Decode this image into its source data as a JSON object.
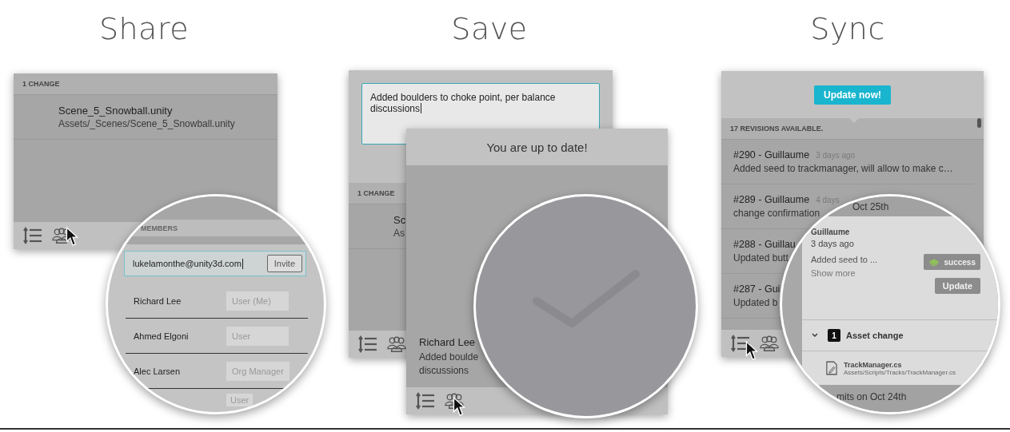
{
  "share": {
    "title": "Share",
    "changes": {
      "header": "1 CHANGE",
      "items": [
        {
          "name": "Scene_5_Snowball.unity",
          "path": "Assets/_Scenes/Scene_5_Snowball.unity"
        }
      ]
    },
    "members": {
      "header": "MEMBERS",
      "invite_field": {
        "value": "lukelamonthe@unity3d.com"
      },
      "invite_button": "Invite",
      "rows": [
        {
          "name": "Richard Lee",
          "role": "User (Me)"
        },
        {
          "name": "Ahmed Elgoni",
          "role": "User"
        },
        {
          "name": "Alec Larsen",
          "role": "Org Manager"
        },
        {
          "role": "User"
        }
      ]
    }
  },
  "save": {
    "title": "Save",
    "message_field": {
      "value": "Added boulders to choke point, per balance discussions"
    },
    "changes": {
      "header": "1 CHANGE",
      "items": [
        {
          "name": "Sc",
          "path": "As"
        }
      ]
    },
    "status": "You are up to date!",
    "last_commit": {
      "author": "Richard Lee",
      "message_lines": [
        "Added boulde",
        "discussions"
      ]
    }
  },
  "sync": {
    "title": "Sync",
    "update_button": "Update now!",
    "header": "17 REVISIONS AVAILABLE.",
    "revisions": [
      {
        "title": "#290 - Guillaume",
        "time": "3 days ago",
        "message": "Added seed to trackmanager, will allow to make c…"
      },
      {
        "title": "#289 - Guillaume",
        "time": "4 days",
        "message": "change confirmation"
      },
      {
        "title": "#288 - Guillau",
        "message": "Updated butt"
      },
      {
        "title": "#287 - Gui",
        "message": "Updated b"
      }
    ],
    "detail": {
      "group_top": "Oct 25th",
      "author": "Guillaume",
      "time": "3 days ago",
      "message": "Added seed to ...",
      "show_more": "Show more",
      "status_badge": "success",
      "update_button": "Update",
      "asset_group": {
        "count": "1",
        "label": "Asset change",
        "expanded": true,
        "files": [
          {
            "name": "TrackManager.cs",
            "path": "Assets/Scripts/Tracks/TrackManager.cs"
          }
        ]
      },
      "group_bottom": "mits on Oct 24th"
    }
  }
}
